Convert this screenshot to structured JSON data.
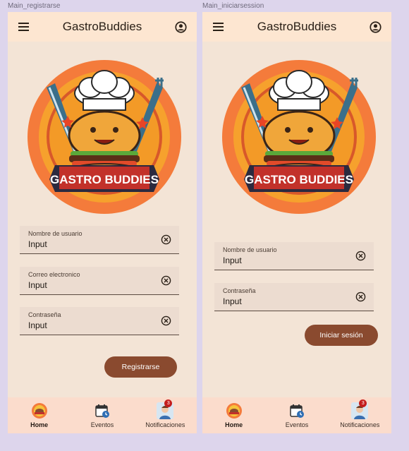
{
  "screens": [
    {
      "frame_label": "Main_registrarse",
      "app_title": "GastroBuddies",
      "logo_text": "GASTRO BUDDIES",
      "fields": [
        {
          "label": "Nombre de usuario",
          "value": "Input"
        },
        {
          "label": "Correo electronico",
          "value": "Input"
        },
        {
          "label": "Contraseña",
          "value": "Input"
        }
      ],
      "primary_button": "Registrarse",
      "nav": [
        {
          "label": "Home",
          "icon": "home-logo-icon"
        },
        {
          "label": "Eventos",
          "icon": "calendar-clock-icon"
        },
        {
          "label": "Notificaciones",
          "icon": "notification-avatar-icon",
          "badge": "3"
        }
      ]
    },
    {
      "frame_label": "Main_iniciarsession",
      "app_title": "GastroBuddies",
      "logo_text": "GASTRO BUDDIES",
      "fields": [
        {
          "label": "Nombre de usuario",
          "value": "Input"
        },
        {
          "label": "Contraseña",
          "value": "Input"
        }
      ],
      "primary_button": "Iniciar sesión",
      "nav": [
        {
          "label": "Home",
          "icon": "home-logo-icon"
        },
        {
          "label": "Eventos",
          "icon": "calendar-clock-icon"
        },
        {
          "label": "Notificaciones",
          "icon": "notification-avatar-icon",
          "badge": "3"
        }
      ]
    }
  ],
  "colors": {
    "background": "#ddd5ec",
    "screen": "#f3e4d6",
    "appbar": "#fde6d1",
    "field": "#ecdcd0",
    "button": "#8a4a2f",
    "bottom_nav": "#fbdccc",
    "logo_orange": "#f47b3b"
  }
}
